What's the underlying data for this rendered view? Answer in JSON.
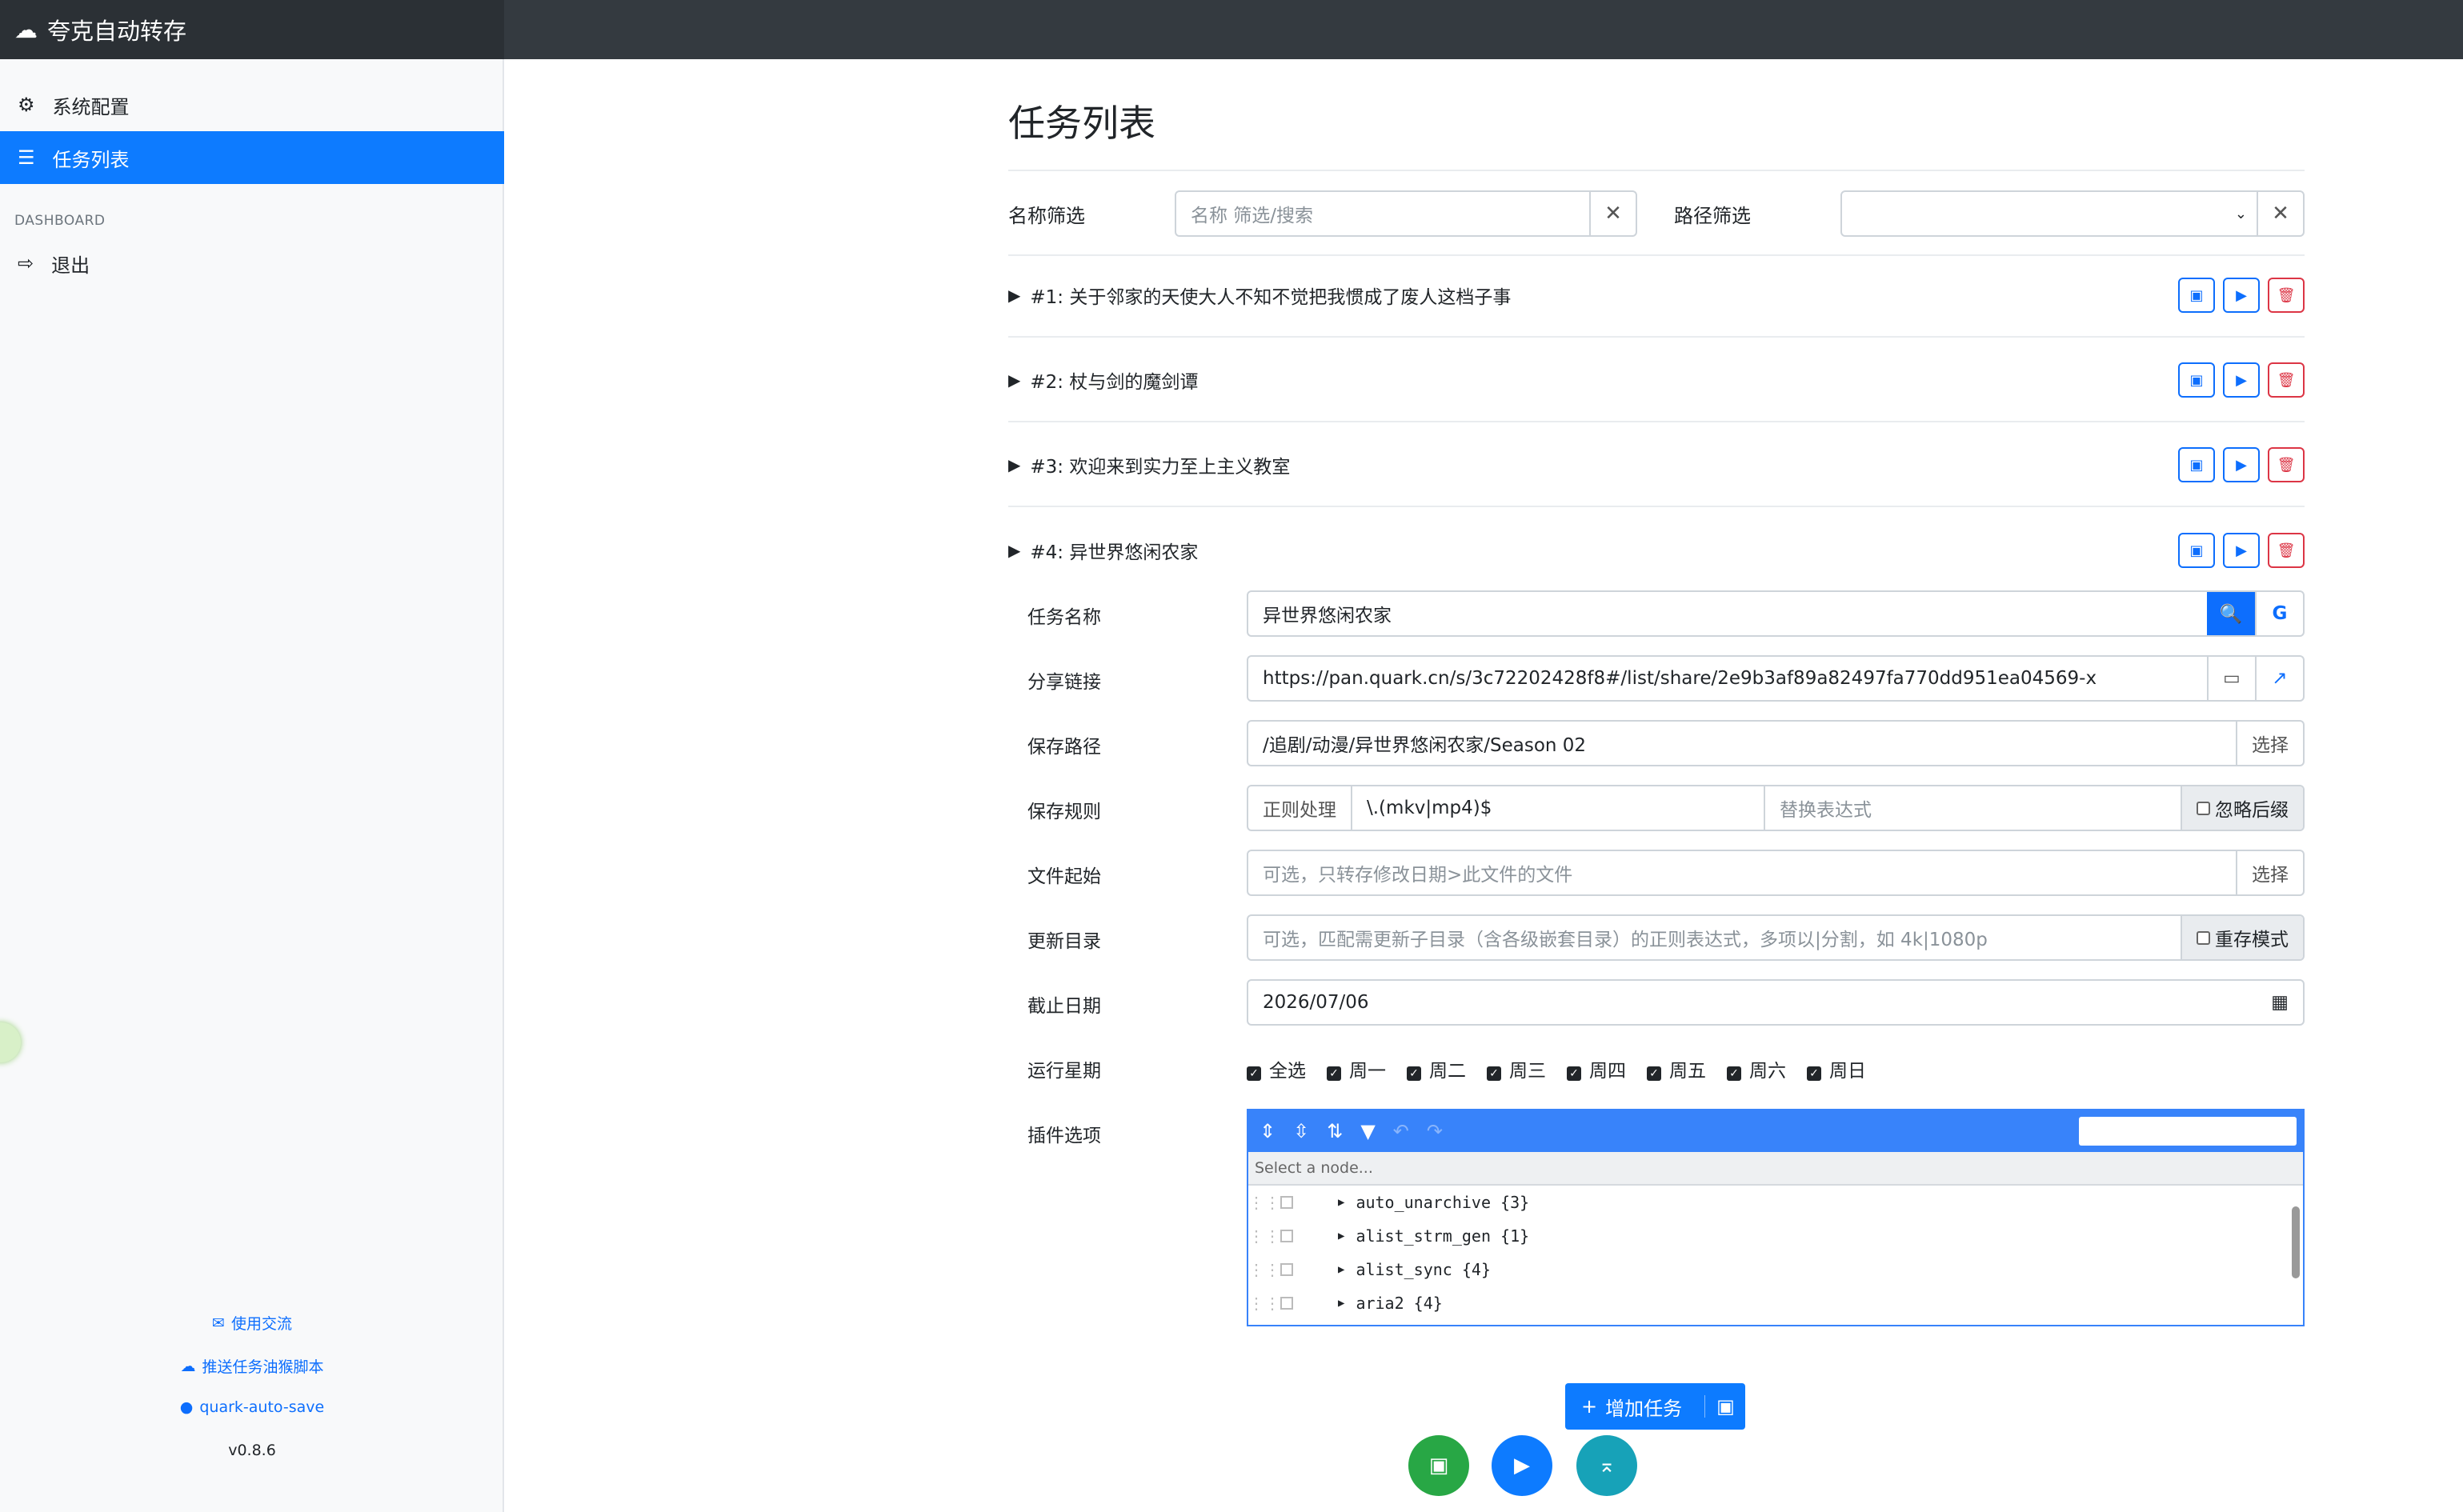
{
  "app": {
    "title": "夸克自动转存"
  },
  "sidebar": {
    "items": [
      {
        "label": "系统配置"
      },
      {
        "label": "任务列表"
      }
    ],
    "heading": "DASHBOARD",
    "logout": "退出",
    "footer": {
      "chat": "使用交流",
      "push": "推送任务油猴脚本",
      "repo": "quark-auto-save",
      "version": "v0.8.6"
    }
  },
  "page": {
    "title": "任务列表",
    "filters": {
      "name_label": "名称筛选",
      "name_placeholder": "名称 筛选/搜索",
      "path_label": "路径筛选"
    },
    "tasks": [
      {
        "label": "#1: 关于邻家的天使大人不知不觉把我惯成了废人这档子事"
      },
      {
        "label": "#2: 杖与剑的魔剑谭"
      },
      {
        "label": "#3: 欢迎来到实力至上主义教室"
      },
      {
        "label": "#4: 异世界悠闲农家"
      }
    ],
    "form": {
      "name_label": "任务名称",
      "name_value": "异世界悠闲农家",
      "share_label": "分享链接",
      "share_value": "https://pan.quark.cn/s/3c72202428f8#/list/share/2e9b3af89a82497fa770dd951ea04569-x",
      "save_label": "保存路径",
      "save_value": "/追剧/动漫/异世界悠闲农家/Season 02",
      "select_btn": "选择",
      "rule_label": "保存规则",
      "regex_btn": "正则处理",
      "pattern_value": "\\.(mkv|mp4)$",
      "replace_placeholder": "替换表达式",
      "ignore_ext": "忽略后缀",
      "start_label": "文件起始",
      "start_placeholder": "可选，只转存修改日期>此文件的文件",
      "update_label": "更新目录",
      "update_placeholder": "可选，匹配需更新子目录（含各级嵌套目录）的正则表达式，多项以|分割，如 4k|1080p",
      "rename_mode": "重存模式",
      "end_label": "截止日期",
      "end_value": "2026/07/06",
      "week_label": "运行星期",
      "weekdays": [
        "全选",
        "周一",
        "周二",
        "周三",
        "周四",
        "周五",
        "周六",
        "周日"
      ],
      "plugin_label": "插件选项",
      "plugin_nav": "Select a node...",
      "plugins": [
        "auto_unarchive {3}",
        "alist_strm_gen {1}",
        "alist_sync {4}",
        "aria2 {4}"
      ]
    },
    "add_task": "增加任务"
  }
}
